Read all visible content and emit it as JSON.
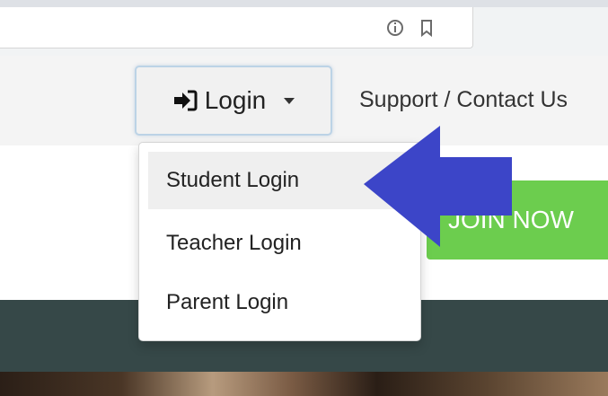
{
  "browser": {
    "icons": [
      "info-icon",
      "bookmark-star-icon"
    ]
  },
  "nav": {
    "login_label": "Login",
    "support_label": "Support / Contact Us"
  },
  "dropdown": {
    "items": [
      {
        "label": "Student Login",
        "active": true
      },
      {
        "label": "Teacher Login",
        "active": false
      },
      {
        "label": "Parent Login",
        "active": false
      }
    ]
  },
  "hero": {
    "join_label": "JOIN NOW"
  },
  "colors": {
    "join_green": "#6ccd4e",
    "annotation_arrow": "#3c45c8",
    "dark_band": "#364848"
  }
}
